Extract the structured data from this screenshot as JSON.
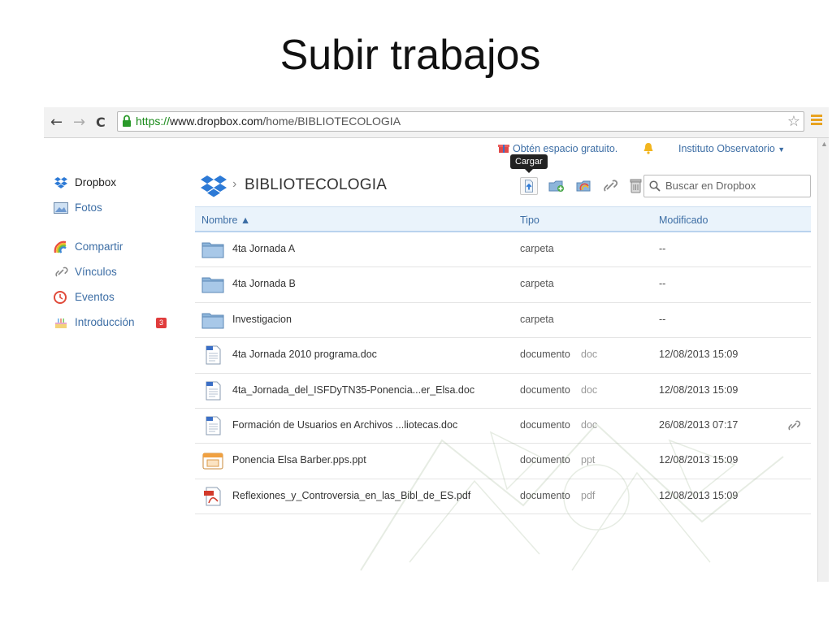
{
  "slide": {
    "title": "Subir trabajos"
  },
  "browser": {
    "back_glyph": "←",
    "forward_glyph": "→",
    "reload_glyph": "C",
    "url": {
      "scheme": "https://",
      "host": "www.dropbox.com",
      "path": "/home/BIBLIOTECOLOGIA"
    },
    "star_glyph": "☆"
  },
  "topbar": {
    "offer_link": "Obtén espacio gratuito.",
    "user_name": "Instituto Observatorio",
    "user_caret": "▼"
  },
  "tooltip": "Cargar",
  "nav": {
    "items": [
      {
        "label": "Dropbox",
        "icon": "dropbox-icon"
      },
      {
        "label": "Fotos",
        "icon": "photos-icon"
      },
      {
        "label": "Compartir",
        "icon": "rainbow-icon"
      },
      {
        "label": "Vínculos",
        "icon": "link-icon"
      },
      {
        "label": "Eventos",
        "icon": "clock-icon"
      },
      {
        "label": "Introducción",
        "icon": "cake-icon"
      }
    ],
    "intro_badge": "3"
  },
  "folder": {
    "chevron": "›",
    "title": "BIBLIOTECOLOGIA"
  },
  "search": {
    "placeholder": "Buscar en Dropbox"
  },
  "table": {
    "headers": {
      "name": "Nombre ▲",
      "type": "Tipo",
      "modified": "Modificado"
    },
    "rows": [
      {
        "name": "4ta Jornada A",
        "type": "carpeta",
        "ext": "",
        "date": "--",
        "icon": "folder-icon",
        "shared": false
      },
      {
        "name": "4ta Jornada B",
        "type": "carpeta",
        "ext": "",
        "date": "--",
        "icon": "folder-icon",
        "shared": false
      },
      {
        "name": "Investigacion",
        "type": "carpeta",
        "ext": "",
        "date": "--",
        "icon": "folder-icon",
        "shared": false
      },
      {
        "name": "4ta Jornada 2010 programa.doc",
        "type": "documento",
        "ext": "doc",
        "date": "12/08/2013 15:09",
        "icon": "word-doc-icon",
        "shared": false
      },
      {
        "name": "4ta_Jornada_del_ISFDyTN35-Ponencia...er_Elsa.doc",
        "type": "documento",
        "ext": "doc",
        "date": "12/08/2013 15:09",
        "icon": "word-doc-icon",
        "shared": false
      },
      {
        "name": "Formación de Usuarios en Archivos ...liotecas.doc",
        "type": "documento",
        "ext": "doc",
        "date": "26/08/2013 07:17",
        "icon": "word-doc-icon",
        "shared": true
      },
      {
        "name": "Ponencia Elsa Barber.pps.ppt",
        "type": "documento",
        "ext": "ppt",
        "date": "12/08/2013 15:09",
        "icon": "ppt-icon",
        "shared": false
      },
      {
        "name": "Reflexiones_y_Controversia_en_las_Bibl_de_ES.pdf",
        "type": "documento",
        "ext": "pdf",
        "date": "12/08/2013 15:09",
        "icon": "pdf-icon",
        "shared": false
      }
    ]
  },
  "colors": {
    "link": "#3d6ea5",
    "dropbox_blue": "#2d7ad6",
    "header_bg": "#eaf3fb",
    "badge": "#e03c3c"
  }
}
